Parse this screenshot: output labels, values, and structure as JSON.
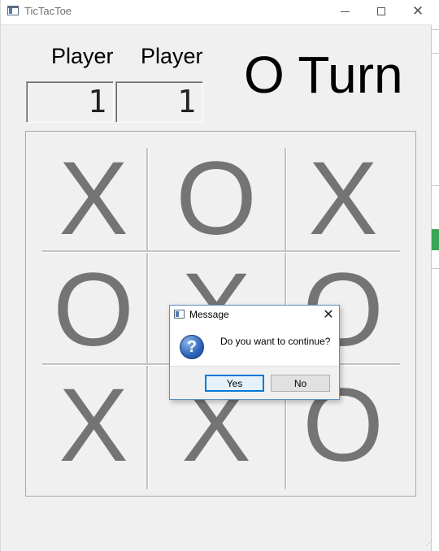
{
  "window": {
    "title": "TicTacToe",
    "minimize": "—",
    "close": "✕"
  },
  "scoreboard": {
    "player1_label": "Player",
    "player2_label": "Player",
    "player1_score": "1",
    "player2_score": "1"
  },
  "turn": {
    "text": "O Turn"
  },
  "board": {
    "cells": [
      "X",
      "O",
      "X",
      "O",
      "X",
      "O",
      "X",
      "X",
      "O"
    ]
  },
  "dialog": {
    "title": "Message",
    "close": "✕",
    "icon": "question-icon",
    "icon_glyph": "?",
    "message": "Do you want to continue?",
    "yes_label": "Yes",
    "no_label": "No"
  },
  "colors": {
    "mark": "#747474",
    "accent": "#0078d7",
    "dialog_border": "#5b8fc6"
  }
}
